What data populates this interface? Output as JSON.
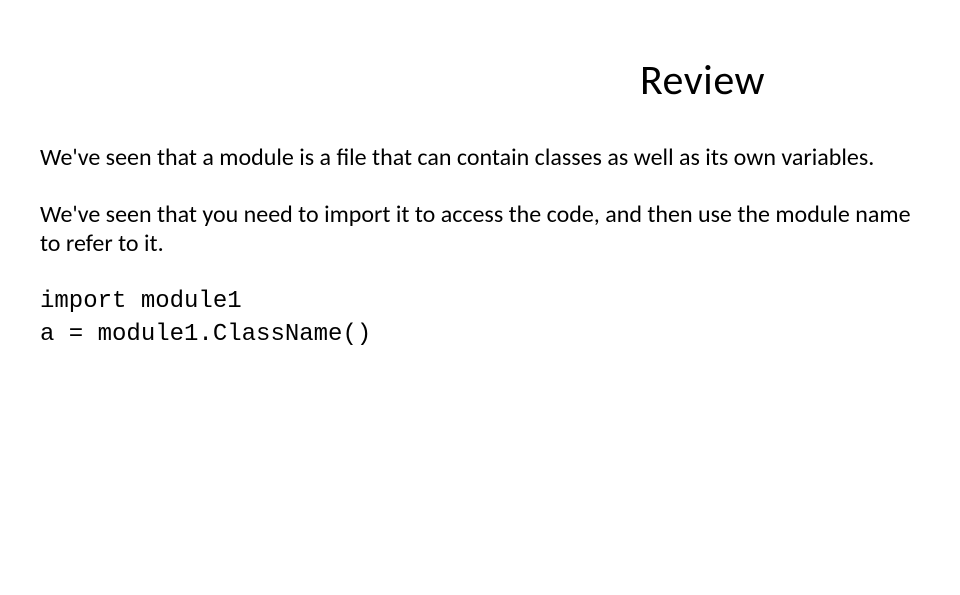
{
  "title": "Review",
  "paragraphs": [
    "We've seen that a module is a file that can contain classes as well as its own variables.",
    "We've seen that you need to import it to access the code, and then use the module name to refer to it."
  ],
  "code": {
    "line1": "import module1",
    "line2": "a = module1.ClassName()"
  }
}
